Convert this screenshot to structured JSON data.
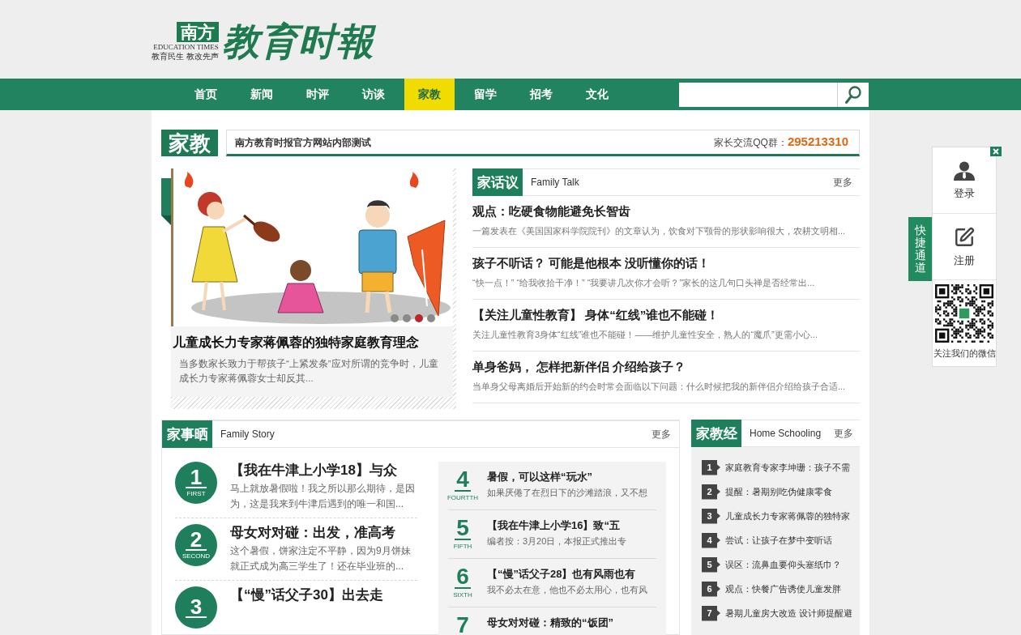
{
  "header": {
    "logo": {
      "badge": "南方",
      "english": "EDUCATION TIMES",
      "slogan": "教育民生 教改先声",
      "calligraphy": "教育时報"
    }
  },
  "nav": {
    "items": [
      {
        "label": "首页",
        "selected": false
      },
      {
        "label": "新闻",
        "selected": false
      },
      {
        "label": "时评",
        "selected": false
      },
      {
        "label": "访谈",
        "selected": false
      },
      {
        "label": "家教",
        "selected": true
      },
      {
        "label": "留学",
        "selected": false
      },
      {
        "label": "招考",
        "selected": false
      },
      {
        "label": "文化",
        "selected": false
      }
    ]
  },
  "banner": {
    "section": "家教",
    "notice": "南方教育时报官方网站内部测试",
    "qq_label": "家长交流QQ群：",
    "qq_number": "295213310"
  },
  "carousel": {
    "title": "儿童成长力专家蒋佩蓉的独特家庭教育理念",
    "summary": "当多数家长致力于帮孩子“上紧发条”应对所谓的竞争时，儿童成长力专家蒋佩蓉女士却反其...",
    "dots": [
      {
        "selected": false
      },
      {
        "selected": false
      },
      {
        "selected": true
      },
      {
        "selected": false
      }
    ]
  },
  "family_talk": {
    "title": "家话议",
    "subtitle": "Family Talk",
    "more": "更多",
    "articles": [
      {
        "title": "观点：吃硬食物能避免长智齿",
        "summary": "一篇发表在《美国国家科学院院刊》的文章认为，饮食对下颚骨的形状影响很大，农耕文明相..."
      },
      {
        "title": "孩子不听话？ 可能是他根本 没听懂你的话！",
        "summary": "“快一点！” “给我收拾干净！” “我要讲几次你才会听？”家长的这几句口头禅是否经常出..."
      },
      {
        "title": "【关注儿童性教育】 身体“红线”谁也不能碰！",
        "summary": "关注儿童性教育3身体“红线”谁也不能碰！——维护儿童性安全，熟人的“魔爪”更需小心..."
      },
      {
        "title": "单身爸妈， 怎样把新伴侣 介绍给孩子？",
        "summary": "当单身父母离婚后开始新的约会时常会面临以下问题：什么时候把我的新伴侣介绍给孩子合适..."
      }
    ]
  },
  "family_story": {
    "title": "家事晒",
    "subtitle": "Family Story",
    "more": "更多",
    "featured": [
      {
        "number": "1",
        "ordinal": "FIRST",
        "title": "【我在牛津上小学18】与众",
        "summary": "马上就放暑假啦！我之所以那么期待，是因为，这是我来到牛津后遇到的唯一和国..."
      },
      {
        "number": "2",
        "ordinal": "SECOND",
        "title": "母女对对碰：出发，准高考",
        "summary": "这个暑假，饼家注定不平静，因为9月饼妹就正式成为高三学生了！还在毕业班的..."
      },
      {
        "number": "3",
        "title": "【“慢”话父子30】出去走"
      }
    ],
    "list": [
      {
        "number": "4",
        "ordinal": "FOURTTH",
        "title": "暑假，可以这样“玩水”",
        "summary": "如果厌倦了在烈日下的沙滩踏浪，又不想"
      },
      {
        "number": "5",
        "ordinal": "FIFTH",
        "title": "【我在牛津上小学16】致“五",
        "summary": "编者按：3月20日，本报正式推出专"
      },
      {
        "number": "6",
        "ordinal": "SIXTH",
        "title": "【“慢”话父子28】也有风雨也有",
        "summary": "我不必太在意，他也不必太用心，也有风"
      },
      {
        "number": "7",
        "title": "母女对对碰：精致的“饭团”"
      }
    ]
  },
  "home_schooling": {
    "title": "家教经",
    "subtitle": "Home Schooling",
    "more": "更多",
    "items": [
      {
        "number": "1",
        "title": "家庭教育专家李坤珊：孩子不需"
      },
      {
        "number": "2",
        "title": "提醒：暑期别吃伪健康零食"
      },
      {
        "number": "3",
        "title": "儿童成长力专家蒋佩蓉的独特家"
      },
      {
        "number": "4",
        "title": "尝试：让孩子在梦中变听话"
      },
      {
        "number": "5",
        "title": "误区：流鼻血要仰头塞纸巾？"
      },
      {
        "number": "6",
        "title": "观点：快餐广告诱使儿童发胖"
      },
      {
        "number": "7",
        "title": "暑期儿童房大改造 设计师提醒避"
      }
    ]
  },
  "quick_panel": {
    "tab": "快捷通道",
    "links": [
      {
        "kind": "login",
        "label": "登录"
      },
      {
        "kind": "register",
        "label": "注册"
      }
    ],
    "qr_caption": "关注我们的微信"
  }
}
